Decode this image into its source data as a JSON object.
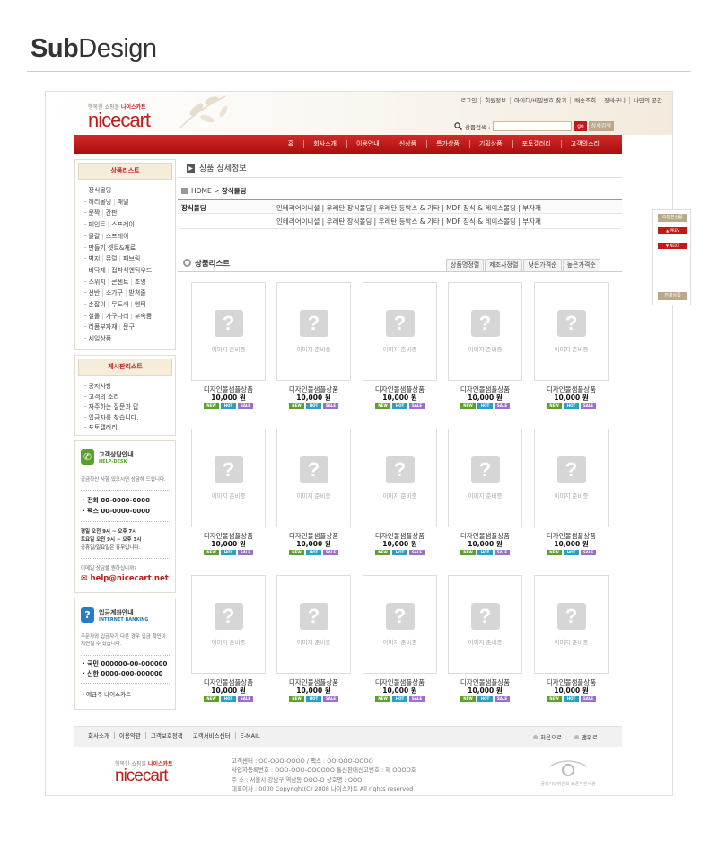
{
  "page": {
    "title_bold": "Sub",
    "title_rest": "Design"
  },
  "brand": {
    "tagline_prefix": "행복한 쇼핑몰",
    "tagline_name": "나이스카트",
    "name": "nicecart"
  },
  "top_links": [
    "로그인",
    "회원정보",
    "아이디/비밀번호 찾기",
    "배송조회",
    "장바구니",
    "나만의 공간"
  ],
  "search": {
    "label": "상품검색 :",
    "value": "",
    "go": "go",
    "advanced": "상세검색"
  },
  "nav": [
    "홈",
    "회사소개",
    "이용안내",
    "신상품",
    "특가상품",
    "기획상품",
    "포토갤러리",
    "고객의소리"
  ],
  "sidebar": {
    "products_title": "상품리스트",
    "products": [
      [
        "장식몰딩"
      ],
      [
        "허리몰딩",
        "패널"
      ],
      [
        "문짝",
        "간판"
      ],
      [
        "페인트",
        "스프레이"
      ],
      [
        "몰갈",
        "스프레이"
      ],
      [
        "만들기 셋트&재료"
      ],
      [
        "벽지",
        "뮤럴",
        "패브릭"
      ],
      [
        "바닥재",
        "접착식엔틱우드"
      ],
      [
        "스위치",
        "콘센트",
        "조명"
      ],
      [
        "선반",
        "소가구",
        "받쳐줄"
      ],
      [
        "손잡이",
        "무도색",
        "엔틱"
      ],
      [
        "철물",
        "가구다리",
        "부속품"
      ],
      [
        "리폼부자재",
        "문구"
      ],
      [
        "세일상품"
      ]
    ],
    "board_title": "게시판리스트",
    "board": [
      "공지사항",
      "고객의 소리",
      "자주하는 질문과 답",
      "입금자를 찾습니다.",
      "포토갤러리"
    ]
  },
  "help": {
    "icon": "phone-icon",
    "title": "고객상담안내",
    "subtitle": "HELP-DESK",
    "desc": "궁금하신 사항 있으시면 상담해 드립니다.",
    "phone": "전화 00-0000-0000",
    "fax": "팩스 00-0000-0000",
    "hours1": "평일  오전 9시 ~ 오후 7시",
    "hours2": "토요일 오전 9시 ~ 오후 3시",
    "hours3": "공휴일/일요일은 휴무입니다.",
    "email_prompt": "이메일 상담을 원하십니까?",
    "email": "help@nicecart.net"
  },
  "bank": {
    "icon": "question-icon",
    "title": "입금계좌안내",
    "subtitle": "INTERNET BANKING",
    "desc": "주문자와 입금자가 다른 경우 입금 확인이 지연될 수 있습니다.",
    "acct1": "국민  000000-00-000000",
    "acct2": "신한  0000-000-000000",
    "holder": "예금주  나이스카트"
  },
  "content": {
    "section_title": "상품 상세정보",
    "breadcrumb_home": "HOME >",
    "breadcrumb_current": "장식몰딩",
    "category_label": "장식몰딩",
    "category_line1": "인테리어이니셜  |  우레탄 장식몰딩  |  우레탄 등박스 & 기타  |  MDF 장식 & 레이스몰딩  |  부자재",
    "category_line2": "인테리어이니셜  |  우레탄 장식몰딩  |  우레탄 등박스 & 기타  |  MDF 장식 & 레이스몰딩  |  부자재",
    "product_list_title": "상품리스트",
    "sort_tabs": [
      "상품명정렬",
      "제조사정렬",
      "낮은가격순",
      "높은가격순"
    ]
  },
  "product": {
    "image_text": "이미지 준비중",
    "name": "디자인몰샘플상품",
    "price": "10,000 원",
    "badges": [
      "NEW",
      "HOT",
      "SALE"
    ]
  },
  "quick": {
    "recent": "오늘본상품",
    "prev": "▲ PREV",
    "next": "▼ NEXT",
    "all": "전체상품"
  },
  "footer": {
    "links": [
      "회사소개",
      "이용약관",
      "고객보호정책",
      "고객서비스센터",
      "E-MAIL"
    ],
    "first": "처음으로",
    "top": "맨위로",
    "info": [
      "고객센터 : OO-OOO-OOOO / 팩스 : OO-OOO-OOOO",
      "사업자등록번호 : OOO-OOO-OOOOOO    통신판매신고번호 : 제 OOOO호",
      "주 소 : 서울시 강남구 역삼동 OOO-O  상호명 : OOO",
      "대표이사 : 0000 Copyright(C) 2008 나이스카트 All rights reserved"
    ],
    "seal": "공정거래위원회 표준약관사용"
  },
  "colors": {
    "accent": "#c21a1a",
    "nav": "#b5151a"
  }
}
